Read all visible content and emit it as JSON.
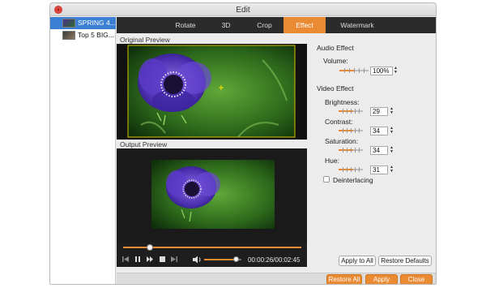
{
  "window": {
    "title": "Edit"
  },
  "files": [
    {
      "label": "SPRING 4...",
      "selected": true
    },
    {
      "label": "Top 5 BIG...",
      "selected": false
    }
  ],
  "tabs": [
    {
      "label": "Rotate",
      "active": false
    },
    {
      "label": "3D",
      "active": false
    },
    {
      "label": "Crop",
      "active": false
    },
    {
      "label": "Effect",
      "active": true
    },
    {
      "label": "Watermark",
      "active": false
    }
  ],
  "preview": {
    "original_label": "Original Preview",
    "output_label": "Output Preview"
  },
  "player": {
    "progress": 0.15,
    "volume": 0.85,
    "time": "00:00:26/00:02:45",
    "icons": [
      "prev-icon",
      "pause-icon",
      "forward-icon",
      "stop-icon",
      "next-icon",
      "volume-icon"
    ]
  },
  "audio": {
    "title": "Audio Effect",
    "volume_label": "Volume:",
    "volume_value": "100%",
    "volume_level": 0.5
  },
  "video": {
    "title": "Video Effect",
    "brightness_label": "Brightness:",
    "brightness_value": "29",
    "brightness_level": 0.6,
    "contrast_label": "Contrast:",
    "contrast_value": "34",
    "contrast_level": 0.6,
    "saturation_label": "Saturation:",
    "saturation_value": "34",
    "saturation_level": 0.6,
    "hue_label": "Hue:",
    "hue_value": "31",
    "hue_level": 0.6,
    "deinterlacing_label": "Deinterlacing"
  },
  "buttons": {
    "apply_all": "Apply to All",
    "restore_defaults": "Restore Defaults",
    "restore_all": "Restore All",
    "apply": "Apply",
    "close": "Close"
  },
  "colors": {
    "accent": "#ea8a33",
    "tabbar": "#2b2b2b",
    "selection": "#3a7fd4"
  }
}
